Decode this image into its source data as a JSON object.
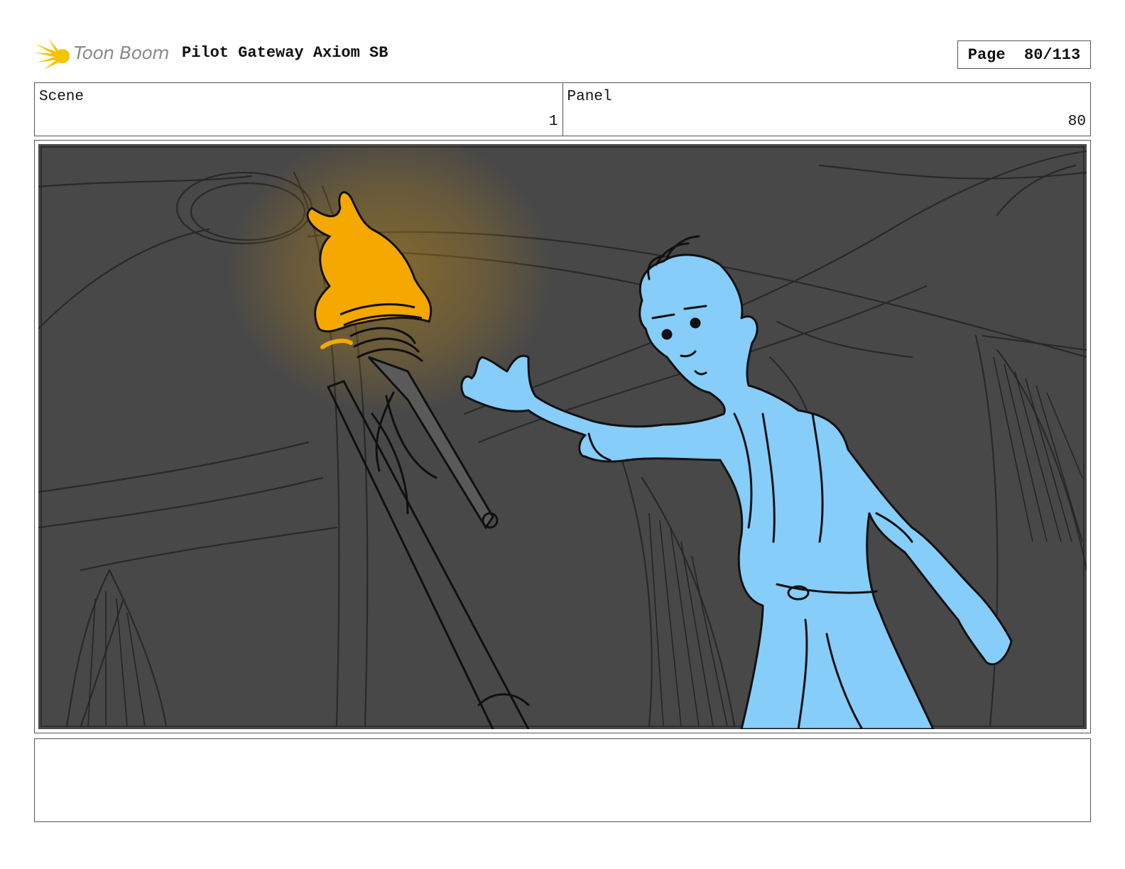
{
  "header": {
    "logo_text": "Toon Boom",
    "project_title": "Pilot Gateway Axiom SB",
    "page_label": "Page",
    "page_value": "80/113"
  },
  "info": {
    "scene_label": "Scene",
    "scene_value": "1",
    "panel_label": "Panel",
    "panel_value": "80"
  },
  "panel": {
    "background_color": "#484848",
    "flame_color": "#f5a800",
    "character_color": "#86cdfa"
  },
  "notes": {}
}
